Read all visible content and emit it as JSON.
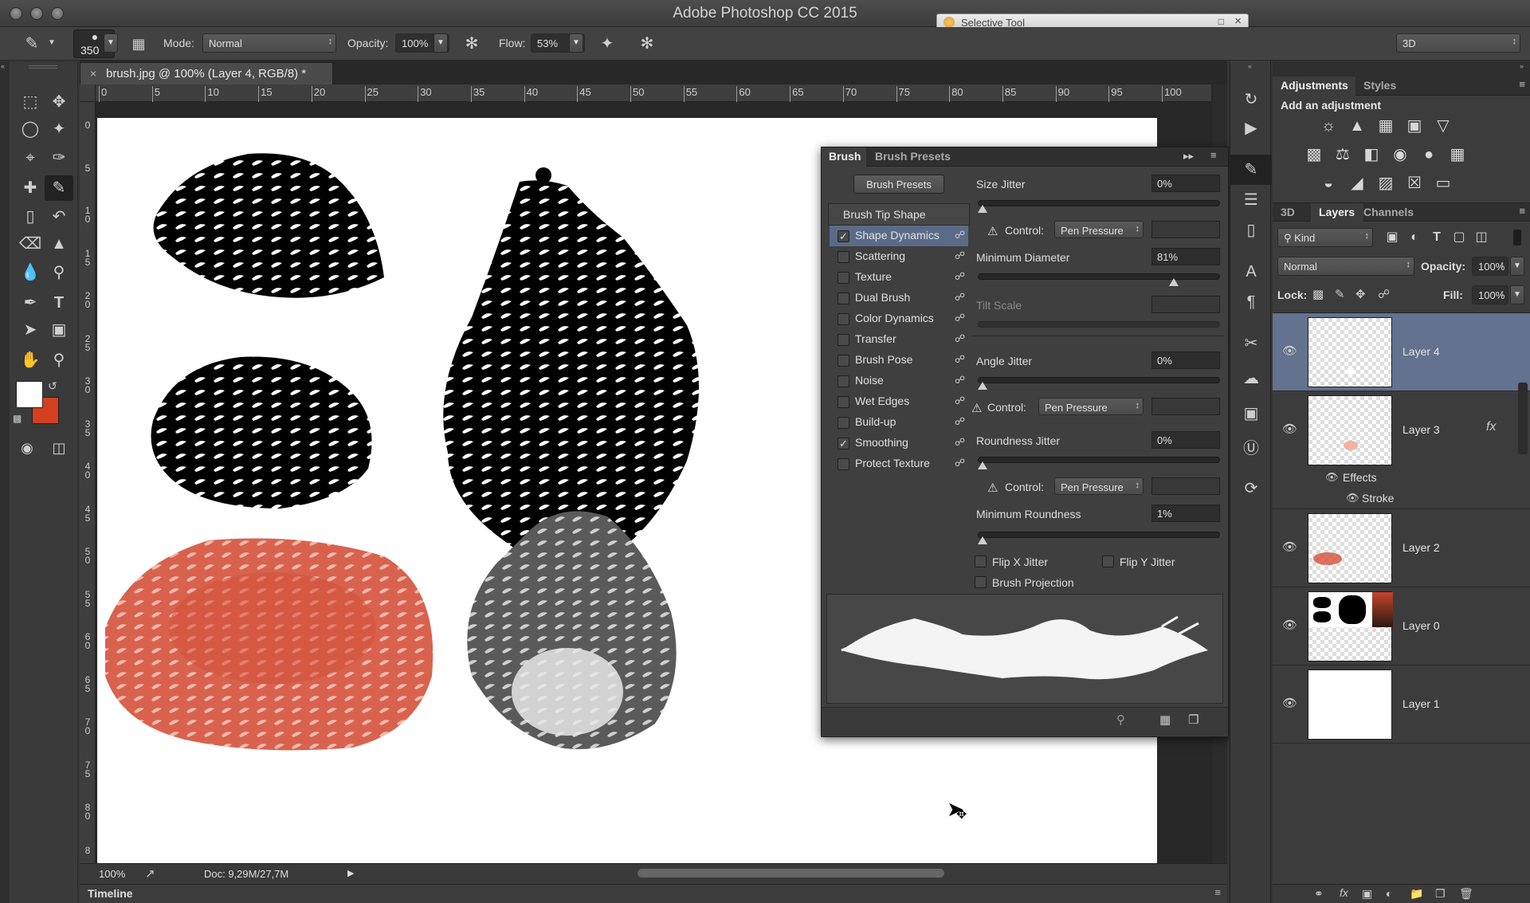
{
  "app": {
    "title": "Adobe Photoshop CC 2015"
  },
  "selective_tool": {
    "title": "Selective Tool"
  },
  "options": {
    "brush_size": "350",
    "mode_label": "Mode:",
    "mode_value": "Normal",
    "opacity_label": "Opacity:",
    "opacity_value": "100%",
    "flow_label": "Flow:",
    "flow_value": "53%",
    "workspace": "3D"
  },
  "document": {
    "tab_title": "brush.jpg @ 100% (Layer 4, RGB/8) *",
    "zoom": "100%",
    "doc_info": "Doc: 9,29M/27,7M",
    "ruler_top": [
      "0",
      "5",
      "10",
      "15",
      "20",
      "25",
      "30",
      "35",
      "40",
      "45",
      "50",
      "55",
      "60",
      "65",
      "70",
      "75",
      "80",
      "85",
      "90",
      "95",
      "100"
    ],
    "ruler_left": [
      "0",
      "5",
      "10",
      "15",
      "20",
      "25",
      "30",
      "35",
      "40",
      "45",
      "50",
      "55",
      "60",
      "65",
      "70",
      "75",
      "80",
      "8"
    ]
  },
  "timeline": {
    "label": "Timeline"
  },
  "brush_panel": {
    "tab_brush": "Brush",
    "tab_presets": "Brush Presets",
    "presets_button": "Brush Presets",
    "tip_shape": "Brush Tip Shape",
    "items": [
      {
        "label": "Shape Dynamics",
        "checked": true,
        "selected": true
      },
      {
        "label": "Scattering",
        "checked": false
      },
      {
        "label": "Texture",
        "checked": false
      },
      {
        "label": "Dual Brush",
        "checked": false
      },
      {
        "label": "Color Dynamics",
        "checked": false
      },
      {
        "label": "Transfer",
        "checked": false
      },
      {
        "label": "Brush Pose",
        "checked": false
      },
      {
        "label": "Noise",
        "checked": false
      },
      {
        "label": "Wet Edges",
        "checked": false
      },
      {
        "label": "Build-up",
        "checked": false
      },
      {
        "label": "Smoothing",
        "checked": true
      },
      {
        "label": "Protect Texture",
        "checked": false
      }
    ],
    "size_jitter_label": "Size Jitter",
    "size_jitter": "0%",
    "control_label": "Control:",
    "control_value": "Pen Pressure",
    "min_diameter_label": "Minimum Diameter",
    "min_diameter": "81%",
    "min_diameter_level": 0.81,
    "tilt_scale_label": "Tilt Scale",
    "angle_jitter_label": "Angle Jitter",
    "angle_jitter": "0%",
    "roundness_jitter_label": "Roundness Jitter",
    "roundness_jitter": "0%",
    "min_roundness_label": "Minimum Roundness",
    "min_roundness": "1%",
    "flip_x": "Flip X Jitter",
    "flip_y": "Flip Y Jitter",
    "brush_projection": "Brush Projection"
  },
  "adjustments": {
    "tab_adjustments": "Adjustments",
    "tab_styles": "Styles",
    "heading": "Add an adjustment"
  },
  "layers_panel": {
    "tab_3d": "3D",
    "tab_layers": "Layers",
    "tab_channels": "Channels",
    "filter_kind": "Kind",
    "blend_mode": "Normal",
    "opacity_label": "Opacity:",
    "opacity": "100%",
    "lock_label": "Lock:",
    "fill_label": "Fill:",
    "fill": "100%",
    "effects_label": "Effects",
    "stroke_label": "Stroke",
    "fx": "fx",
    "layers": [
      "Layer 4",
      "Layer 3",
      "Layer 2",
      "Layer 0",
      "Layer 1"
    ]
  },
  "colors": {
    "foreground": "#ffffff",
    "background": "#d4401f",
    "selection": "#62728f",
    "rust": "#d4503a"
  }
}
